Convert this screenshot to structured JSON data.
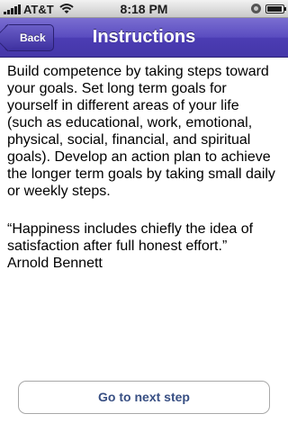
{
  "status_bar": {
    "carrier": "AT&T",
    "time": "8:18 PM",
    "signal_icon": "signal-bars-icon",
    "wifi_icon": "wifi-icon",
    "lock_icon": "orientation-lock-icon",
    "battery_icon": "battery-icon"
  },
  "nav": {
    "back_label": "Back",
    "title": "Instructions",
    "bar_color": "#5a4cc0"
  },
  "content": {
    "paragraph": "Build competence by taking steps toward your goals. Set long term goals for yourself in different areas of your life (such as educational, work, emotional, physical, social, financial, and spiritual goals). Develop an action plan to achieve the longer term goals by taking small daily or weekly steps.",
    "quote": "“Happiness includes chiefly the idea of satisfaction after full honest effort.”",
    "quote_author": "Arnold Bennett"
  },
  "actions": {
    "next_label": "Go to next step",
    "next_color": "#384f83"
  }
}
